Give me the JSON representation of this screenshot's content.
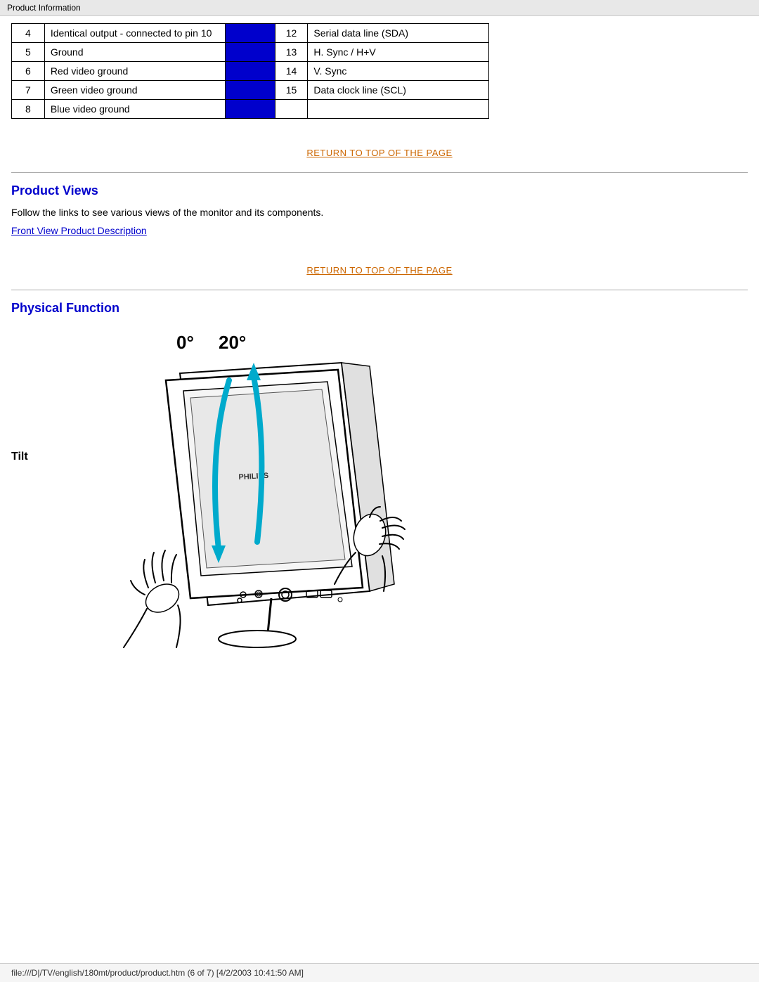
{
  "topbar": {
    "label": "Product Information"
  },
  "table": {
    "rows_left": [
      {
        "num": "4",
        "desc": "Identical output - connected to pin 10"
      },
      {
        "num": "5",
        "desc": "Ground"
      },
      {
        "num": "6",
        "desc": "Red video ground"
      },
      {
        "num": "7",
        "desc": "Green video ground"
      },
      {
        "num": "8",
        "desc": "Blue video ground"
      }
    ],
    "rows_right": [
      {
        "num": "12",
        "desc": "Serial data line (SDA)"
      },
      {
        "num": "13",
        "desc": "H. Sync / H+V"
      },
      {
        "num": "14",
        "desc": "V. Sync"
      },
      {
        "num": "15",
        "desc": "Data clock line (SCL)"
      }
    ]
  },
  "return_link": {
    "text": "RETURN TO TOP OF THE PAGE"
  },
  "product_views": {
    "heading": "Product Views",
    "intro": "Follow the links to see various views of the monitor and its components.",
    "link_text": "Front View Product Description"
  },
  "physical_function": {
    "heading": "Physical Function",
    "tilt_label": "Tilt",
    "angle_zero": "0°",
    "angle_twenty": "20°",
    "brand_label": "PHILIPS"
  },
  "statusbar": {
    "text": "file:///D|/TV/english/180mt/product/product.htm (6 of 7) [4/2/2003 10:41:50 AM]"
  }
}
